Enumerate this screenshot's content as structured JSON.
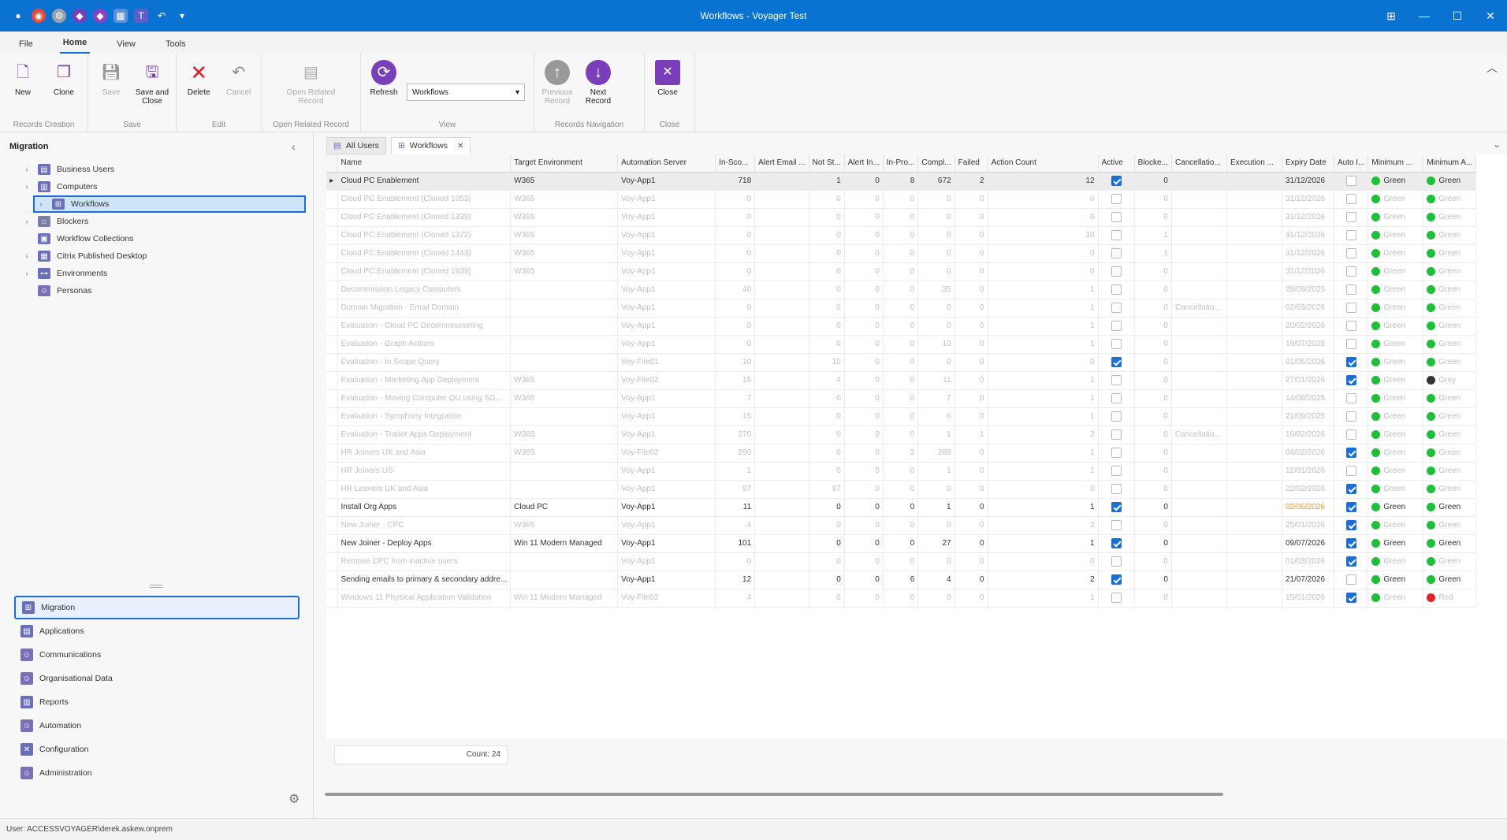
{
  "window": {
    "title": "Workflows - Voyager Test",
    "controls": [
      "⊞",
      "—",
      "☐",
      "✕"
    ]
  },
  "ribbon_tabs": [
    "File",
    "Home",
    "View",
    "Tools"
  ],
  "ribbon": {
    "groups": [
      {
        "label": "Records Creation",
        "buttons": [
          {
            "label": "New"
          },
          {
            "label": "Clone"
          }
        ]
      },
      {
        "label": "Save",
        "buttons": [
          {
            "label": "Save"
          },
          {
            "label": "Save and Close"
          }
        ]
      },
      {
        "label": "Edit",
        "buttons": [
          {
            "label": "Delete"
          },
          {
            "label": "Cancel"
          }
        ]
      },
      {
        "label": "Open Related Record",
        "buttons": [
          {
            "label": "Open Related Record"
          }
        ]
      },
      {
        "label": "View",
        "buttons": [
          {
            "label": "Refresh"
          }
        ],
        "select_value": "Workflows"
      },
      {
        "label": "Records Navigation",
        "buttons": [
          {
            "label": "Previous Record"
          },
          {
            "label": "Next Record"
          }
        ]
      },
      {
        "label": "Close",
        "buttons": [
          {
            "label": "Close"
          }
        ]
      }
    ]
  },
  "sidebar": {
    "title": "Migration",
    "tree": [
      {
        "label": "Business Users",
        "expandable": true
      },
      {
        "label": "Computers",
        "expandable": true
      },
      {
        "label": "Workflows",
        "expandable": true,
        "selected": true
      },
      {
        "label": "Blockers",
        "expandable": true
      },
      {
        "label": "Workflow Collections",
        "expandable": false
      },
      {
        "label": "Citrix Published Desktop",
        "expandable": true
      },
      {
        "label": "Environments",
        "expandable": true
      },
      {
        "label": "Personas",
        "expandable": false
      }
    ],
    "nav": [
      {
        "label": "Migration",
        "selected": true
      },
      {
        "label": "Applications"
      },
      {
        "label": "Communications"
      },
      {
        "label": "Organisational Data"
      },
      {
        "label": "Reports"
      },
      {
        "label": "Automation"
      },
      {
        "label": "Configuration"
      },
      {
        "label": "Administration"
      }
    ]
  },
  "main": {
    "tabs": [
      {
        "label": "All Users",
        "active": false
      },
      {
        "label": "Workflows",
        "active": true,
        "close": "✕"
      }
    ],
    "columns": [
      "Name",
      "Target Environment",
      "Automation Server",
      "In-Sco...",
      "Alert Email ...",
      "Not St...",
      "Alert In...",
      "In-Pro...",
      "Compl...",
      "Failed",
      "Action Count",
      "Active",
      "Blocke...",
      "Cancellatio...",
      "Execution ...",
      "Expiry Date",
      "Auto I...",
      "Minimum ...",
      "Minimum A..."
    ],
    "rows": [
      {
        "name": "Cloud PC Enablement",
        "target": "W365",
        "server": "Voy-App1",
        "in_scope": "718",
        "alert_email": "",
        "not_started": "1",
        "alert_in": "0",
        "in_progress": "8",
        "completed": "672",
        "failed": "2",
        "action_count": "12",
        "active": true,
        "blockers": "0",
        "cancellation": "",
        "execution": "",
        "expiry": "31/12/2026",
        "expiry_color": "black",
        "auto": false,
        "min1": "Green",
        "min1_color": "green",
        "min2": "Green",
        "min2_color": "green",
        "state": "first"
      },
      {
        "name": "Cloud PC Enablement (Cloned 1053)",
        "target": "W365",
        "server": "Voy-App1",
        "in_scope": "0",
        "alert_email": "",
        "not_started": "0",
        "alert_in": "0",
        "in_progress": "0",
        "completed": "0",
        "failed": "0",
        "action_count": "0",
        "active": false,
        "blockers": "0",
        "cancellation": "",
        "execution": "",
        "expiry": "31/12/2026",
        "expiry_color": "grey",
        "auto": false,
        "min1": "Green",
        "min1_color": "green",
        "min2": "Green",
        "min2_color": "green",
        "state": "inactive"
      },
      {
        "name": "Cloud PC Enablement (Cloned 1339)",
        "target": "W365",
        "server": "Voy-App1",
        "in_scope": "0",
        "alert_email": "",
        "not_started": "0",
        "alert_in": "0",
        "in_progress": "0",
        "completed": "0",
        "failed": "0",
        "action_count": "0",
        "active": false,
        "blockers": "0",
        "cancellation": "",
        "execution": "",
        "expiry": "31/12/2026",
        "expiry_color": "grey",
        "auto": false,
        "min1": "Green",
        "min1_color": "green",
        "min2": "Green",
        "min2_color": "green",
        "state": "inactive"
      },
      {
        "name": "Cloud PC Enablement (Cloned 1372)",
        "target": "W365",
        "server": "Voy-App1",
        "in_scope": "0",
        "alert_email": "",
        "not_started": "0",
        "alert_in": "0",
        "in_progress": "0",
        "completed": "0",
        "failed": "0",
        "action_count": "10",
        "active": false,
        "blockers": "1",
        "cancellation": "",
        "execution": "",
        "expiry": "31/12/2026",
        "expiry_color": "grey",
        "auto": false,
        "min1": "Green",
        "min1_color": "green",
        "min2": "Green",
        "min2_color": "green",
        "state": "inactive"
      },
      {
        "name": "Cloud PC Enablement (Cloned 1443)",
        "target": "W365",
        "server": "Voy-App1",
        "in_scope": "0",
        "alert_email": "",
        "not_started": "0",
        "alert_in": "0",
        "in_progress": "0",
        "completed": "0",
        "failed": "0",
        "action_count": "0",
        "active": false,
        "blockers": "1",
        "cancellation": "",
        "execution": "",
        "expiry": "31/12/2026",
        "expiry_color": "grey",
        "auto": false,
        "min1": "Green",
        "min1_color": "green",
        "min2": "Green",
        "min2_color": "green",
        "state": "inactive"
      },
      {
        "name": "Cloud PC Enablement (Cloned 1939)",
        "target": "W365",
        "server": "Voy-App1",
        "in_scope": "0",
        "alert_email": "",
        "not_started": "0",
        "alert_in": "0",
        "in_progress": "0",
        "completed": "0",
        "failed": "0",
        "action_count": "0",
        "active": false,
        "blockers": "0",
        "cancellation": "",
        "execution": "",
        "expiry": "31/12/2026",
        "expiry_color": "grey",
        "auto": false,
        "min1": "Green",
        "min1_color": "green",
        "min2": "Green",
        "min2_color": "green",
        "state": "inactive"
      },
      {
        "name": "Decommission Legacy Computers",
        "target": "",
        "server": "Voy-App1",
        "in_scope": "40",
        "alert_email": "",
        "not_started": "0",
        "alert_in": "0",
        "in_progress": "0",
        "completed": "35",
        "failed": "0",
        "action_count": "1",
        "active": false,
        "blockers": "0",
        "cancellation": "",
        "execution": "",
        "expiry": "28/09/2025",
        "expiry_color": "red",
        "auto": false,
        "min1": "Green",
        "min1_color": "green",
        "min2": "Green",
        "min2_color": "green",
        "state": "inactive"
      },
      {
        "name": "Domain Migration - Email Domain",
        "target": "",
        "server": "Voy-App1",
        "in_scope": "0",
        "alert_email": "",
        "not_started": "0",
        "alert_in": "0",
        "in_progress": "0",
        "completed": "0",
        "failed": "0",
        "action_count": "1",
        "active": false,
        "blockers": "0",
        "cancellation": "Cancellatio...",
        "execution": "",
        "expiry": "02/03/2026",
        "expiry_color": "red",
        "auto": false,
        "min1": "Green",
        "min1_color": "green",
        "min2": "Green",
        "min2_color": "green",
        "state": "inactive"
      },
      {
        "name": "Evaluation - Cloud PC Decommissioning",
        "target": "",
        "server": "Voy-App1",
        "in_scope": "0",
        "alert_email": "",
        "not_started": "0",
        "alert_in": "0",
        "in_progress": "0",
        "completed": "0",
        "failed": "0",
        "action_count": "1",
        "active": false,
        "blockers": "0",
        "cancellation": "",
        "execution": "",
        "expiry": "20/02/2026",
        "expiry_color": "red",
        "auto": false,
        "min1": "Green",
        "min1_color": "green",
        "min2": "Green",
        "min2_color": "green",
        "state": "inactive"
      },
      {
        "name": "Evaluation - Graph Actions",
        "target": "",
        "server": "Voy-App1",
        "in_scope": "0",
        "alert_email": "",
        "not_started": "0",
        "alert_in": "0",
        "in_progress": "0",
        "completed": "10",
        "failed": "0",
        "action_count": "1",
        "active": false,
        "blockers": "0",
        "cancellation": "",
        "execution": "",
        "expiry": "19/07/2025",
        "expiry_color": "red",
        "auto": false,
        "min1": "Green",
        "min1_color": "green",
        "min2": "Green",
        "min2_color": "green",
        "state": "inactive"
      },
      {
        "name": "Evaluation - In Scope Query",
        "target": "",
        "server": "Voy-File01",
        "in_scope": "10",
        "alert_email": "",
        "not_started": "10",
        "alert_in": "0",
        "in_progress": "0",
        "completed": "0",
        "failed": "0",
        "action_count": "0",
        "active": true,
        "blockers": "0",
        "cancellation": "",
        "execution": "",
        "expiry": "01/05/2026",
        "expiry_color": "red",
        "auto": true,
        "min1": "Green",
        "min1_color": "green",
        "min2": "Green",
        "min2_color": "green",
        "state": "inactive"
      },
      {
        "name": "Evaluation - Marketing App Deployment",
        "target": "W365",
        "server": "Voy-File02",
        "in_scope": "15",
        "alert_email": "",
        "not_started": "4",
        "alert_in": "0",
        "in_progress": "0",
        "completed": "11",
        "failed": "0",
        "action_count": "1",
        "active": false,
        "blockers": "0",
        "cancellation": "",
        "execution": "",
        "expiry": "27/01/2026",
        "expiry_color": "red",
        "auto": true,
        "min1": "Green",
        "min1_color": "green",
        "min2": "Grey",
        "min2_color": "black",
        "state": "inactive"
      },
      {
        "name": "Evaluation - Moving Computer OU using SG...",
        "target": "W365",
        "server": "Voy-App1",
        "in_scope": "7",
        "alert_email": "",
        "not_started": "0",
        "alert_in": "0",
        "in_progress": "0",
        "completed": "7",
        "failed": "0",
        "action_count": "1",
        "active": false,
        "blockers": "0",
        "cancellation": "",
        "execution": "",
        "expiry": "14/08/2025",
        "expiry_color": "red",
        "auto": false,
        "min1": "Green",
        "min1_color": "green",
        "min2": "Green",
        "min2_color": "green",
        "state": "inactive"
      },
      {
        "name": "Evaluation - Symphony Integration",
        "target": "",
        "server": "Voy-App1",
        "in_scope": "15",
        "alert_email": "",
        "not_started": "0",
        "alert_in": "0",
        "in_progress": "0",
        "completed": "6",
        "failed": "0",
        "action_count": "1",
        "active": false,
        "blockers": "0",
        "cancellation": "",
        "execution": "",
        "expiry": "21/09/2025",
        "expiry_color": "red",
        "auto": false,
        "min1": "Green",
        "min1_color": "green",
        "min2": "Green",
        "min2_color": "green",
        "state": "inactive"
      },
      {
        "name": "Evaluation - Trader Apps Deployment",
        "target": "W365",
        "server": "Voy-App1",
        "in_scope": "270",
        "alert_email": "",
        "not_started": "0",
        "alert_in": "0",
        "in_progress": "0",
        "completed": "1",
        "failed": "1",
        "action_count": "2",
        "active": false,
        "blockers": "0",
        "cancellation": "Cancellatio...",
        "execution": "",
        "expiry": "16/02/2026",
        "expiry_color": "red",
        "auto": false,
        "min1": "Green",
        "min1_color": "green",
        "min2": "Green",
        "min2_color": "green",
        "state": "inactive"
      },
      {
        "name": "HR Joiners UK and Asia",
        "target": "W365",
        "server": "Voy-File02",
        "in_scope": "290",
        "alert_email": "",
        "not_started": "0",
        "alert_in": "0",
        "in_progress": "2",
        "completed": "288",
        "failed": "0",
        "action_count": "1",
        "active": false,
        "blockers": "0",
        "cancellation": "",
        "execution": "",
        "expiry": "04/02/2026",
        "expiry_color": "red",
        "auto": true,
        "min1": "Green",
        "min1_color": "green",
        "min2": "Green",
        "min2_color": "green",
        "state": "inactive"
      },
      {
        "name": "HR Joiners US",
        "target": "",
        "server": "Voy-App1",
        "in_scope": "1",
        "alert_email": "",
        "not_started": "0",
        "alert_in": "0",
        "in_progress": "0",
        "completed": "1",
        "failed": "0",
        "action_count": "1",
        "active": false,
        "blockers": "0",
        "cancellation": "",
        "execution": "",
        "expiry": "12/01/2026",
        "expiry_color": "red",
        "auto": false,
        "min1": "Green",
        "min1_color": "green",
        "min2": "Green",
        "min2_color": "green",
        "state": "inactive"
      },
      {
        "name": "HR Leavers UK and Asia",
        "target": "",
        "server": "Voy-App1",
        "in_scope": "97",
        "alert_email": "",
        "not_started": "97",
        "alert_in": "0",
        "in_progress": "0",
        "completed": "0",
        "failed": "0",
        "action_count": "0",
        "active": false,
        "blockers": "0",
        "cancellation": "",
        "execution": "",
        "expiry": "22/02/2026",
        "expiry_color": "red",
        "auto": true,
        "min1": "Green",
        "min1_color": "green",
        "min2": "Green",
        "min2_color": "green",
        "state": "inactive"
      },
      {
        "name": "Install Org Apps",
        "target": "Cloud PC",
        "server": "Voy-App1",
        "in_scope": "11",
        "alert_email": "",
        "not_started": "0",
        "alert_in": "0",
        "in_progress": "0",
        "completed": "1",
        "failed": "0",
        "action_count": "1",
        "active": true,
        "blockers": "0",
        "cancellation": "",
        "execution": "",
        "expiry": "02/06/2026",
        "expiry_color": "orange",
        "auto": true,
        "min1": "Green",
        "min1_color": "green",
        "min2": "Green",
        "min2_color": "green",
        "state": "normal"
      },
      {
        "name": "New Joiner - CPC",
        "target": "W365",
        "server": "Voy-App1",
        "in_scope": "4",
        "alert_email": "",
        "not_started": "0",
        "alert_in": "0",
        "in_progress": "0",
        "completed": "0",
        "failed": "0",
        "action_count": "2",
        "active": false,
        "blockers": "0",
        "cancellation": "",
        "execution": "",
        "expiry": "25/01/2026",
        "expiry_color": "red",
        "auto": true,
        "min1": "Green",
        "min1_color": "green",
        "min2": "Green",
        "min2_color": "green",
        "state": "inactive"
      },
      {
        "name": "New Joiner - Deploy Apps",
        "target": "Win 11 Modern Managed",
        "server": "Voy-App1",
        "in_scope": "101",
        "alert_email": "",
        "not_started": "0",
        "alert_in": "0",
        "in_progress": "0",
        "completed": "27",
        "failed": "0",
        "action_count": "1",
        "active": true,
        "blockers": "0",
        "cancellation": "",
        "execution": "",
        "expiry": "09/07/2026",
        "expiry_color": "black",
        "auto": true,
        "min1": "Green",
        "min1_color": "green",
        "min2": "Green",
        "min2_color": "green",
        "state": "normal"
      },
      {
        "name": "Remove CPC from inactive users",
        "target": "",
        "server": "Voy-App1",
        "in_scope": "0",
        "alert_email": "",
        "not_started": "0",
        "alert_in": "0",
        "in_progress": "0",
        "completed": "0",
        "failed": "0",
        "action_count": "0",
        "active": false,
        "blockers": "0",
        "cancellation": "",
        "execution": "",
        "expiry": "01/03/2026",
        "expiry_color": "red",
        "auto": true,
        "min1": "Green",
        "min1_color": "green",
        "min2": "Green",
        "min2_color": "green",
        "state": "inactive"
      },
      {
        "name": "Sending emails to primary & secondary addre...",
        "target": "",
        "server": "Voy-App1",
        "in_scope": "12",
        "alert_email": "",
        "not_started": "0",
        "alert_in": "0",
        "in_progress": "6",
        "completed": "4",
        "failed": "0",
        "action_count": "2",
        "active": true,
        "blockers": "0",
        "cancellation": "",
        "execution": "",
        "expiry": "21/07/2026",
        "expiry_color": "black",
        "auto": false,
        "min1": "Green",
        "min1_color": "green",
        "min2": "Green",
        "min2_color": "green",
        "state": "normal"
      },
      {
        "name": "Windows 11 Physical Application Validation",
        "target": "Win 11 Modern Managed",
        "server": "Voy-File02",
        "in_scope": "4",
        "alert_email": "",
        "not_started": "0",
        "alert_in": "0",
        "in_progress": "0",
        "completed": "0",
        "failed": "0",
        "action_count": "1",
        "active": false,
        "blockers": "0",
        "cancellation": "",
        "execution": "",
        "expiry": "15/01/2026",
        "expiry_color": "red",
        "auto": true,
        "min1": "Green",
        "min1_color": "green",
        "min2": "Red",
        "min2_color": "red",
        "state": "inactive"
      }
    ],
    "count_label": "Count: 24"
  },
  "status_bar": {
    "user": "User: ACCESSVOYAGER\\derek.askew.onprem"
  },
  "colors": {
    "accent": "#0a72d0",
    "green": "#1fbf3a",
    "red": "#e0202a",
    "purple": "#7a3fb8",
    "orange": "#f0a020"
  }
}
